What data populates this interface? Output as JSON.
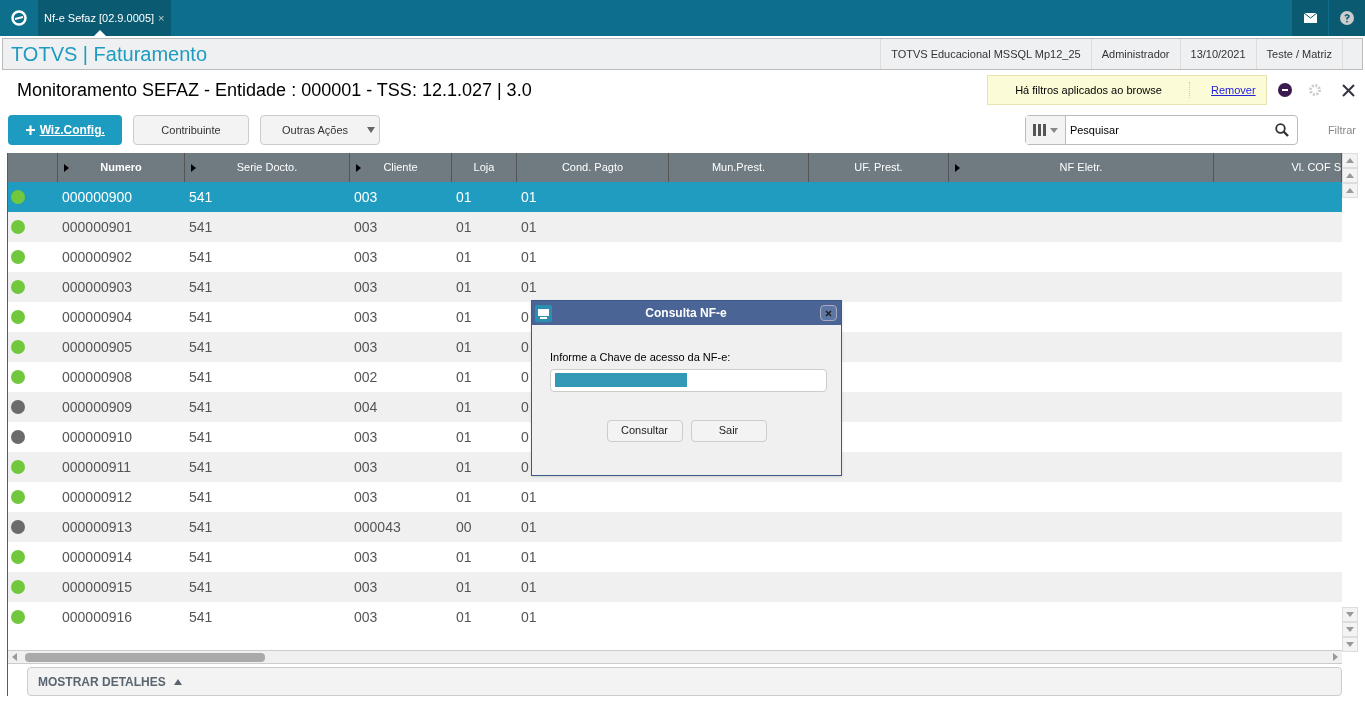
{
  "tab": {
    "label": "Nf-e Sefaz [02.9.0005]",
    "close": "×"
  },
  "header": {
    "title": "TOTVS | Faturamento",
    "info": [
      "TOTVS Educacional MSSQL Mp12_25",
      "Administrador",
      "13/10/2021",
      "Teste / Matriz"
    ]
  },
  "page": {
    "title": "Monitoramento SEFAZ - Entidade : 000001 - TSS: 12.1.027 | 3.0",
    "filter_notice": "Há filtros aplicados ao browse",
    "remove_link": "Remover"
  },
  "toolbar": {
    "buttons": [
      {
        "label": "Wiz.Config.",
        "kind": "primary",
        "icon": "+"
      },
      {
        "label": "Contribuinte",
        "kind": "plain"
      },
      {
        "label": "Outras Ações",
        "kind": "menu"
      }
    ],
    "search": {
      "placeholder": "Pesquisar"
    },
    "filter_label": "Filtrar"
  },
  "table": {
    "columns": [
      {
        "label": "Numero",
        "sortable": true,
        "bold": true
      },
      {
        "label": "Serie Docto.",
        "sortable": true,
        "bold": false
      },
      {
        "label": "Cliente",
        "sortable": true,
        "bold": false
      },
      {
        "label": "Loja",
        "sortable": false,
        "bold": false
      },
      {
        "label": "Cond. Pagto",
        "sortable": false,
        "bold": false
      },
      {
        "label": "Mun.Prest.",
        "sortable": false,
        "bold": false
      },
      {
        "label": "UF. Prest.",
        "sortable": false,
        "bold": false
      },
      {
        "label": "NF Eletr.",
        "sortable": true,
        "bold": false
      },
      {
        "label": "Vl. COF S",
        "sortable": false,
        "bold": false
      }
    ],
    "rows": [
      {
        "color": "#72c83c",
        "selected": true,
        "cells": [
          "000000900",
          "541",
          "003",
          "01",
          "01"
        ]
      },
      {
        "color": "#72c83c",
        "selected": false,
        "cells": [
          "000000901",
          "541",
          "003",
          "01",
          "01"
        ]
      },
      {
        "color": "#72c83c",
        "selected": false,
        "cells": [
          "000000902",
          "541",
          "003",
          "01",
          "01"
        ]
      },
      {
        "color": "#72c83c",
        "selected": false,
        "cells": [
          "000000903",
          "541",
          "003",
          "01",
          "01"
        ]
      },
      {
        "color": "#72c83c",
        "selected": false,
        "cells": [
          "000000904",
          "541",
          "003",
          "01",
          "0"
        ]
      },
      {
        "color": "#72c83c",
        "selected": false,
        "cells": [
          "000000905",
          "541",
          "003",
          "01",
          "0"
        ]
      },
      {
        "color": "#72c83c",
        "selected": false,
        "cells": [
          "000000908",
          "541",
          "002",
          "01",
          "0"
        ]
      },
      {
        "color": "#6b6b6b",
        "selected": false,
        "cells": [
          "000000909",
          "541",
          "004",
          "01",
          "0"
        ]
      },
      {
        "color": "#6b6b6b",
        "selected": false,
        "cells": [
          "000000910",
          "541",
          "003",
          "01",
          "0"
        ]
      },
      {
        "color": "#72c83c",
        "selected": false,
        "cells": [
          "000000911",
          "541",
          "003",
          "01",
          "0"
        ]
      },
      {
        "color": "#72c83c",
        "selected": false,
        "cells": [
          "000000912",
          "541",
          "003",
          "01",
          "01"
        ]
      },
      {
        "color": "#6b6b6b",
        "selected": false,
        "cells": [
          "000000913",
          "541",
          "000043",
          "00",
          "01"
        ]
      },
      {
        "color": "#72c83c",
        "selected": false,
        "cells": [
          "000000914",
          "541",
          "003",
          "01",
          "01"
        ]
      },
      {
        "color": "#72c83c",
        "selected": false,
        "cells": [
          "000000915",
          "541",
          "003",
          "01",
          "01"
        ]
      },
      {
        "color": "#72c83c",
        "selected": false,
        "cells": [
          "000000916",
          "541",
          "003",
          "01",
          "01"
        ]
      }
    ]
  },
  "details_toggle": "MOSTRAR DETALHES",
  "dialog": {
    "title": "Consulta NF-e",
    "label": "Informe a Chave de acesso da NF-e:",
    "buttons": [
      "Consultar",
      "Sair"
    ]
  }
}
